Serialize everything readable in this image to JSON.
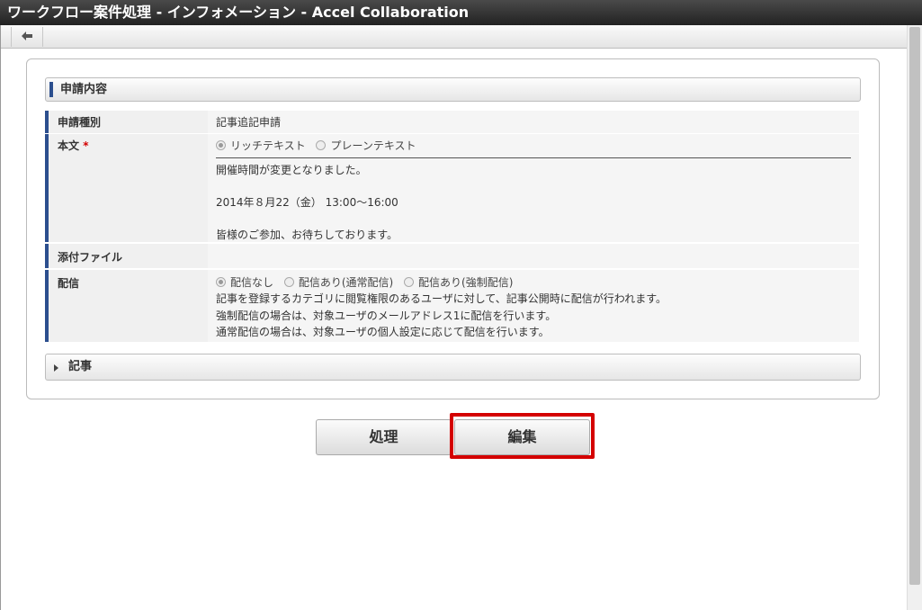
{
  "window": {
    "title": "ワークフロー案件処理 - インフォメーション - Accel Collaboration"
  },
  "toolbar": {
    "back_icon": "arrow-left-icon"
  },
  "application_section": {
    "title": "申請内容"
  },
  "fields": {
    "type": {
      "label": "申請種別",
      "value": "記事追記申請"
    },
    "body": {
      "label": "本文",
      "required_mark": "*",
      "format_options": [
        "リッチテキスト",
        "プレーンテキスト"
      ],
      "selected_format": "リッチテキスト",
      "lines": [
        "開催時間が変更となりました。",
        "2014年８月22（金）  13:00～16:00",
        "皆様のご参加、お待ちしております。"
      ]
    },
    "attachment": {
      "label": "添付ファイル",
      "value": ""
    },
    "delivery": {
      "label": "配信",
      "options": [
        "配信なし",
        "配信あり(通常配信)",
        "配信あり(強制配信)"
      ],
      "selected": "配信なし",
      "notes": [
        "記事を登録するカテゴリに閲覧権限のあるユーザに対して、記事公開時に配信が行われます。",
        "強制配信の場合は、対象ユーザのメールアドレス1に配信を行います。",
        "通常配信の場合は、対象ユーザの個人設定に応じて配信を行います。"
      ]
    }
  },
  "article_section": {
    "title": "記事",
    "expand_icon": "triangle-right-icon"
  },
  "actions": {
    "process_label": "処理",
    "edit_label": "編集"
  },
  "colors": {
    "accent": "#2c4f8e",
    "highlight": "#d40000",
    "required": "#d30000"
  }
}
